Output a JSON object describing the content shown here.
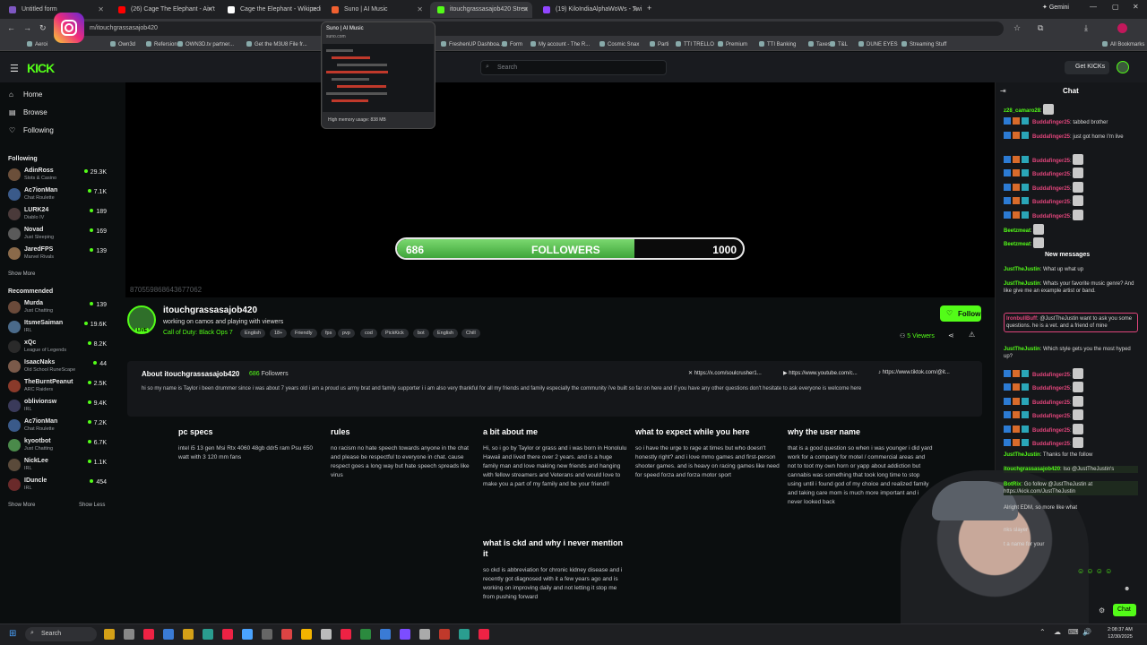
{
  "browser": {
    "tabs": [
      {
        "title": "Untitled form",
        "color": "#7e57c2"
      },
      {
        "title": "(26) Cage The Elephant - Ain't I",
        "color": "#ff0000"
      },
      {
        "title": "Cage the Elephant - Wikipedia",
        "color": "#ffffff"
      },
      {
        "title": "Suno | AI Music",
        "color": "#f06030"
      },
      {
        "title": "itouchgrassasajob420 Strea",
        "color": "#53fc18"
      },
      {
        "title": "(19) KiloIndiaAlphaWoWs - Twi",
        "color": "#9146ff"
      }
    ],
    "gemini_label": "Gemini",
    "url": "m/itouchgrassasajob420",
    "bookmarks": [
      "Aeroi",
      "Own3d",
      "Refersion",
      "OWN3D.tv partner...",
      "Get the M3U8 File fr...",
      "FreshenUP Dashboa...",
      "Form",
      "My account - The R...",
      "Cosmic Snax",
      "Parti",
      "TTI TRELLO",
      "Premium",
      "TTI Banking",
      "Taxes",
      "T&L",
      "DUNE EYES",
      "Streaming Stuff",
      "All Bookmarks"
    ]
  },
  "tooltip": {
    "title": "Suno | AI Music",
    "url": "suno.com",
    "memory": "High memory usage: 838 MB"
  },
  "header": {
    "logo": "KICK",
    "search_placeholder": "Search",
    "get_kicks": "Get KICKs"
  },
  "sidebar": {
    "nav": [
      {
        "label": "Home",
        "icon": "home-icon"
      },
      {
        "label": "Browse",
        "icon": "browse-icon"
      },
      {
        "label": "Following",
        "icon": "heart-icon"
      }
    ],
    "following_title": "Following",
    "following": [
      {
        "name": "AdinRoss",
        "category": "Slots & Casino",
        "viewers": "29.3K",
        "color": "#6b4f3a"
      },
      {
        "name": "Ac7ionMan",
        "category": "Chat Roulette",
        "viewers": "7.1K",
        "color": "#3a5a8a"
      },
      {
        "name": "LURK24",
        "category": "Diablo IV",
        "viewers": "189",
        "color": "#4a3a3a"
      },
      {
        "name": "Novad",
        "category": "Just Sleeping",
        "viewers": "169",
        "color": "#5a5a5a"
      },
      {
        "name": "JaredFPS",
        "category": "Marvel Rivals",
        "viewers": "139",
        "color": "#8a6a4a"
      }
    ],
    "show_more": "Show More",
    "recommended_title": "Recommended",
    "recommended": [
      {
        "name": "Murda",
        "category": "Just Chatting",
        "viewers": "139",
        "color": "#6a4a3a"
      },
      {
        "name": "ItsmeSaiman",
        "category": "IRL",
        "viewers": "19.6K",
        "color": "#4a6a8a"
      },
      {
        "name": "xQc",
        "category": "League of Legends",
        "viewers": "8.2K",
        "color": "#2a2a2a"
      },
      {
        "name": "IsaacNaks",
        "category": "Old School RuneScape",
        "viewers": "44",
        "color": "#7a5a4a"
      },
      {
        "name": "TheBurntPeanut",
        "category": "ARC Raiders",
        "viewers": "2.5K",
        "color": "#8a3a2a"
      },
      {
        "name": "oblivionsw",
        "category": "IRL",
        "viewers": "9.4K",
        "color": "#3a3a5a"
      },
      {
        "name": "Ac7ionMan",
        "category": "Chat Roulette",
        "viewers": "7.2K",
        "color": "#3a5a8a"
      },
      {
        "name": "kyootbot",
        "category": "Just Chatting",
        "viewers": "6.7K",
        "color": "#4a8a4a"
      },
      {
        "name": "NickLee",
        "category": "IRL",
        "viewers": "1.1K",
        "color": "#5a4a3a"
      },
      {
        "name": "IDuncle",
        "category": "IRL",
        "viewers": "454",
        "color": "#6a2a2a"
      }
    ],
    "show_more_2": "Show More",
    "show_less": "Show Less"
  },
  "player": {
    "followers_current": "686",
    "followers_label": "FOLLOWERS",
    "followers_goal": "1000",
    "progress": 0.686,
    "stream_id": "870559868643677062"
  },
  "channel": {
    "name": "itouchgrassasajob420",
    "title": "working on camos and  playing with viewers",
    "category": "Call of Duty: Black Ops 7",
    "tags": [
      "English",
      "18+",
      "Friendly",
      "fps",
      "pvp",
      "cod",
      "PickKick",
      "bot",
      "English",
      "Chill"
    ],
    "follow_label": "Follow",
    "viewers": "5 Viewers",
    "live_badge": "LIVE"
  },
  "about": {
    "title": "About itouchgrassasajob420",
    "followers_count": "686",
    "followers_word": "Followers",
    "bio": "hi so my name is Taylor i been drummer since i was about 7 years old i am a proud us army brat and family supporter i i am also very thankful for all my friends and family especially the community i've built so far on here and if you have any other questions don't hesitate to ask everyone is welcome here",
    "socials": [
      "https://x.com/soulcrusher1...",
      "https://www.youtube.com/c...",
      "https://www.tiktok.com/@it..."
    ]
  },
  "panels": [
    {
      "title": "pc specs",
      "body": "intel i5 13 gen Msi Rtx 4060 48gb ddr5 ram Psu 650 watt with 3 120 mm fans"
    },
    {
      "title": "rules",
      "body": "no racism no hate speech towards anyone in the chat and please be respectful to everyone in chat. cause respect goes a long way but hate speech spreads like virus"
    },
    {
      "title": "a bit about me",
      "body": "Hi, so i go by Taylor or grass and i was born in Honolulu Hawaii and lived there over 2 years. and is a huge family man and love making new friends and hanging with fellow streamers and Veterans and would love to make you a part of my family and be your friend!!"
    },
    {
      "title": "what to expect while you here",
      "body": "so i have the urge to rage at times but who doesn't honestly right? and i love mmo games and first-person shooter games. and is heavy on racing games like need for speed forza and forza motor sport"
    },
    {
      "title": "why the user name",
      "body": "that is a good question so when i was younger i did yard work for a company for motel / commercial areas and not to toot my own horn or yapp about addiction but cannabis was something that took long time to stop using until i found god of my choice and realized family and taking care mom is much more important and i never looked back"
    },
    {
      "title": "what is ckd and why i never mention it",
      "body": "so ckd is abbreviation for chronic kidney disease and i recently got diagnosed with it a few years ago and is working on improving daily and not letting it stop me from pushing forward"
    }
  ],
  "chat": {
    "title": "Chat",
    "new_messages": "New messages",
    "messages": [
      {
        "user": "z28_camaro28",
        "color": "#53fc18",
        "text": "",
        "emote": true
      },
      {
        "user": "Buddafinger25",
        "color": "#e0457b",
        "text": "tabbed brother",
        "emote": false
      },
      {
        "user": "Buddafinger25",
        "color": "#e0457b",
        "text": "just got home I'm live",
        "emote": false
      },
      {
        "user": "Buddafinger25",
        "color": "#e0457b",
        "text": "",
        "emote": true
      },
      {
        "user": "Buddafinger25",
        "color": "#e0457b",
        "text": "",
        "emote": true
      },
      {
        "user": "Buddafinger25",
        "color": "#e0457b",
        "text": "",
        "emote": true
      },
      {
        "user": "Buddafinger25",
        "color": "#e0457b",
        "text": "",
        "emote": true
      },
      {
        "user": "Buddafinger25",
        "color": "#e0457b",
        "text": "",
        "emote": true
      },
      {
        "user": "Beetzmeat",
        "color": "#53fc18",
        "text": "",
        "emote": true
      },
      {
        "user": "Beetzmeat",
        "color": "#53fc18",
        "text": "",
        "emote": true
      },
      {
        "user": "JustTheJustin",
        "color": "#53fc18",
        "text": "What up what up",
        "emote": false
      },
      {
        "user": "JustTheJustin",
        "color": "#53fc18",
        "text": "Whats your favorite music genre? And like give me an example artist or band.",
        "emote": false
      },
      {
        "user": "IronbullBuff",
        "color": "#e0457b",
        "text": "@JustTheJustin want to ask you some questions. he is a vet. and a friend of mine",
        "emote": false
      },
      {
        "user": "JustTheJustin",
        "color": "#53fc18",
        "text": "Which style gets you the most hyped up?",
        "emote": false
      },
      {
        "user": "Buddafinger25",
        "color": "#e0457b",
        "text": "",
        "emote": true
      },
      {
        "user": "Buddafinger25",
        "color": "#e0457b",
        "text": "",
        "emote": true
      },
      {
        "user": "Buddafinger25",
        "color": "#e0457b",
        "text": "",
        "emote": true
      },
      {
        "user": "Buddafinger25",
        "color": "#e0457b",
        "text": "",
        "emote": true
      },
      {
        "user": "Buddafinger25",
        "color": "#e0457b",
        "text": "",
        "emote": true
      },
      {
        "user": "Buddafinger25",
        "color": "#e0457b",
        "text": "",
        "emote": true
      },
      {
        "user": "JustTheJustin",
        "color": "#53fc18",
        "text": "Thanks for the follow",
        "emote": false
      },
      {
        "user": "itouchgrassasajob420",
        "color": "#53fc18",
        "text": "Iso @JustTheJustin's",
        "emote": false
      },
      {
        "user": "BotRix",
        "color": "#53fc18",
        "text": "Go follow @JustTheJustin at https://kick.com/JustTheJustin",
        "emote": false
      },
      {
        "user": "",
        "color": "#53fc18",
        "text": "Alright EDM, so more like what",
        "emote": false
      },
      {
        "user": "",
        "color": "#53fc18",
        "text": "nks slayer",
        "emote": false
      },
      {
        "user": "",
        "color": "#53fc18",
        "text": "t a name for your",
        "emote": false
      }
    ],
    "chat_button": "Chat"
  },
  "taskbar": {
    "search": "Search",
    "time": "2:08:37 AM",
    "date": "12/30/2025"
  }
}
